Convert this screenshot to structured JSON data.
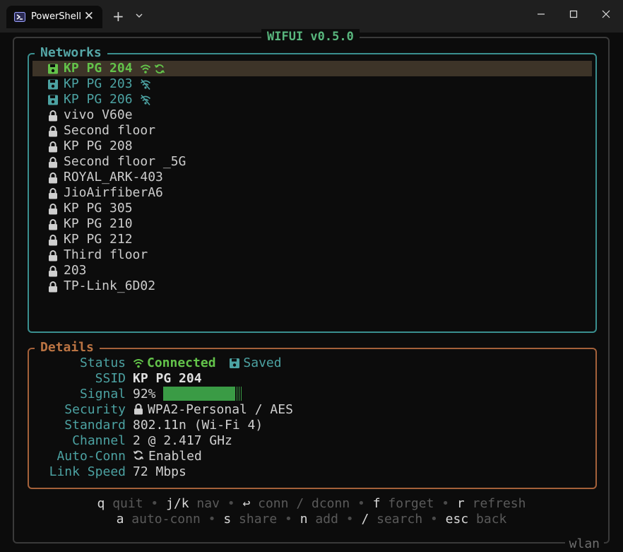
{
  "window": {
    "tab_title": "PowerShell",
    "tab_close": "✕",
    "new_tab": "+",
    "icons": [
      "powershell-icon",
      "close-icon",
      "dropdown-icon",
      "minimize-icon",
      "maximize-icon",
      "window-close-icon"
    ]
  },
  "app": {
    "title": "WIFUI v0.5.0",
    "interface": "wlan"
  },
  "networks": {
    "title": "Networks",
    "items": [
      {
        "name": "KP PG 204",
        "state": "connected",
        "saved": true,
        "icons": [
          "save-icon",
          "wifi-icon",
          "refresh-icon"
        ]
      },
      {
        "name": "KP PG 203",
        "state": "saved",
        "saved": true,
        "icons": [
          "save-icon",
          "wifi-off-icon"
        ]
      },
      {
        "name": "KP PG 206",
        "state": "saved",
        "saved": true,
        "icons": [
          "save-icon",
          "wifi-off-icon"
        ]
      },
      {
        "name": "vivo V60e",
        "state": "secured",
        "saved": false,
        "icons": [
          "lock-icon"
        ]
      },
      {
        "name": "Second floor",
        "state": "secured",
        "saved": false,
        "icons": [
          "lock-icon"
        ]
      },
      {
        "name": "KP PG 208",
        "state": "secured",
        "saved": false,
        "icons": [
          "lock-icon"
        ]
      },
      {
        "name": "Second floor _5G",
        "state": "secured",
        "saved": false,
        "icons": [
          "lock-icon"
        ]
      },
      {
        "name": "ROYAL_ARK-403",
        "state": "secured",
        "saved": false,
        "icons": [
          "lock-icon"
        ]
      },
      {
        "name": "JioAirfiberA6",
        "state": "secured",
        "saved": false,
        "icons": [
          "lock-icon"
        ]
      },
      {
        "name": "KP PG 305",
        "state": "secured",
        "saved": false,
        "icons": [
          "lock-icon"
        ]
      },
      {
        "name": "KP PG 210",
        "state": "secured",
        "saved": false,
        "icons": [
          "lock-icon"
        ]
      },
      {
        "name": "KP PG 212",
        "state": "secured",
        "saved": false,
        "icons": [
          "lock-icon"
        ]
      },
      {
        "name": "Third floor",
        "state": "secured",
        "saved": false,
        "icons": [
          "lock-icon"
        ]
      },
      {
        "name": "203",
        "state": "secured",
        "saved": false,
        "icons": [
          "lock-icon"
        ]
      },
      {
        "name": "TP-Link_6D02",
        "state": "secured",
        "saved": false,
        "icons": [
          "lock-icon"
        ]
      }
    ]
  },
  "details": {
    "title": "Details",
    "labels": {
      "status": "Status",
      "ssid": "SSID",
      "signal": "Signal",
      "security": "Security",
      "standard": "Standard",
      "channel": "Channel",
      "autoconn": "Auto-Conn",
      "linkspeed": "Link Speed"
    },
    "status_value": "Connected",
    "saved_value": "Saved",
    "ssid_value": "KP PG 204",
    "signal_value": "92%",
    "signal_level": 0.92,
    "security_value": "WPA2-Personal / AES",
    "standard_value": "802.11n (Wi-Fi 4)",
    "channel_value": "2 @ 2.417 GHz",
    "autoconn_value": "Enabled",
    "linkspeed_value": "72 Mbps"
  },
  "help": {
    "line1": [
      {
        "key": "q",
        "desc": "quit"
      },
      {
        "key": "j/k",
        "desc": "nav"
      },
      {
        "key": "↩",
        "desc": "conn / dconn"
      },
      {
        "key": "f",
        "desc": "forget"
      },
      {
        "key": "r",
        "desc": "refresh"
      }
    ],
    "line2": [
      {
        "key": "a",
        "desc": "auto-conn"
      },
      {
        "key": "s",
        "desc": "share"
      },
      {
        "key": "n",
        "desc": "add"
      },
      {
        "key": "/",
        "desc": "search"
      },
      {
        "key": "esc",
        "desc": "back"
      }
    ],
    "separator": "•"
  },
  "colors": {
    "accent_green": "#63c34a",
    "teal": "#4ca2a2",
    "orange": "#bb7443",
    "selected_bg": "#3d3428",
    "background": "#0c0c0c"
  }
}
